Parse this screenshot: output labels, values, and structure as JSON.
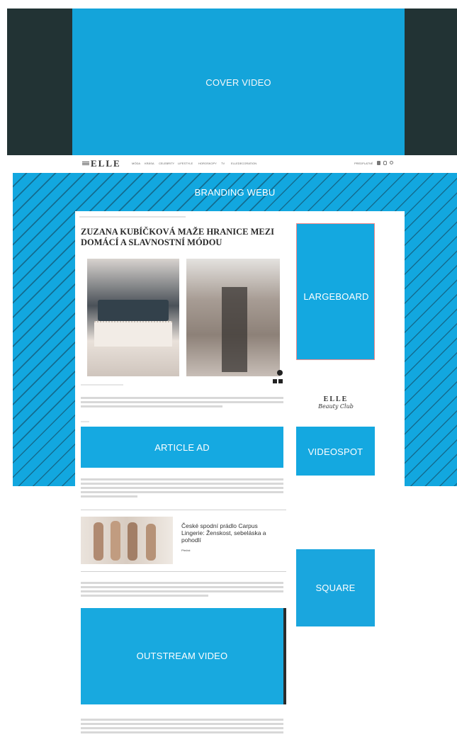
{
  "header": {
    "logo": "ELLE",
    "nav": [
      "MÓDA",
      "KRÁSA",
      "CELEBRITY",
      "LIFESTYLE",
      "HOROSKOPY",
      "TV",
      "ELLEDECORATION"
    ],
    "right_label": "PREDPLATNÉ"
  },
  "ad_slots": {
    "cover_video": "COVER VIDEO",
    "branding": "BRANDING WEBU",
    "largeboard": "LARGEBOARD",
    "article_ad": "ARTICLE AD",
    "videospot": "VIDEOSPOT",
    "square": "SQUARE",
    "outstream": "OUTSTREAM VIDEO"
  },
  "article": {
    "title": "ZUZANA KUBÍČKOVÁ MAŽE HRANICE MEZI DOMÁCÍ A SLAVNOSTNÍ MÓDOU"
  },
  "related": {
    "title": "České spodní prádlo Carpus Lingerie: Ženskost, sebeláska a pohodlí",
    "link": "Přečíst"
  },
  "sidebar": {
    "elle_logo": "ELLE",
    "elle_sub": "Beauty Club"
  },
  "colors": {
    "ad_blue": "#14a8e0",
    "cover_bg": "#223334",
    "stripe": "#143c50"
  }
}
